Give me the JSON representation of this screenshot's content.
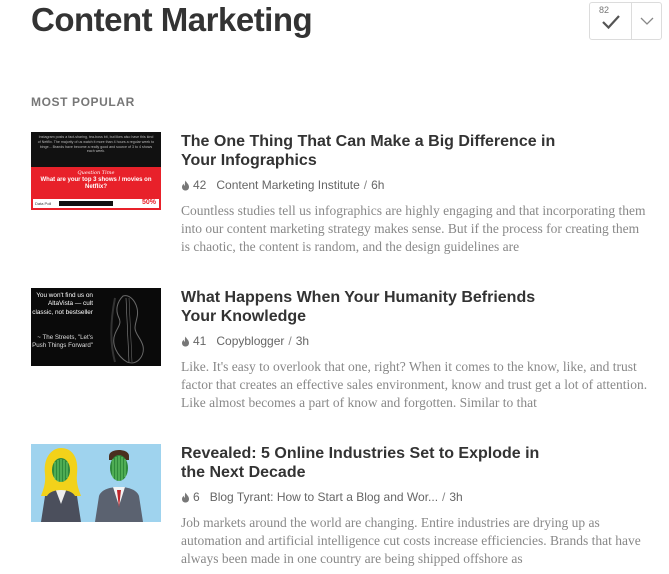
{
  "page": {
    "title": "Content Marketing"
  },
  "follow_control": {
    "count": "82",
    "check_icon": "checkmark-icon",
    "menu_icon": "chevron-down-icon"
  },
  "section": {
    "label": "MOST POPULAR"
  },
  "articles": [
    {
      "headline": "The One Thing That Can Make a Big Difference in Your Infographics",
      "engagement": "42",
      "source": "Content Marketing Institute",
      "age": "6h",
      "summary": "Countless studies tell us infographics are highly engaging and that incorporating them into our content marketing strategy makes sense. But if the process for creating them is chaotic, the content is random, and the design guidelines are",
      "thumbnail": {
        "top_text": "Instagram posts a fact-sharing, tea-boss bit, but likes also have this kind of Netflix. The majority of us watch it more than 4 hours a regular week to binge... Brands have become a really good and source of 3 to 4 shows each week.",
        "quiz_label": "Question Time",
        "question": "What are your top 3 shows / movies on Netflix?",
        "bar_label": "Data Poll",
        "percent": "50%"
      }
    },
    {
      "headline": "What Happens When Your Humanity Befriends Your Knowledge",
      "engagement": "41",
      "source": "Copyblogger",
      "age": "3h",
      "summary": "Like. It's easy to overlook that one, right? When it comes to the know, like, and trust factor that creates an effective sales environment, know and trust get a lot of attention. Like almost becomes a part of know and forgotten. Similar to that",
      "thumbnail": {
        "quote": "You won't find us on AltaVista — cult classic, not bestseller",
        "cite": "~ The Streets, \"Let's Push Things Forward\""
      }
    },
    {
      "headline": "Revealed: 5 Online Industries Set to Explode in the Next Decade",
      "engagement": "6",
      "source": "Blog Tyrant: How to Start a Blog and Wor...",
      "age": "3h",
      "summary": "Job markets around the world are changing. Entire industries are drying up as automation and artificial intelligence cut costs increase efficiencies. Brands that have always been made in one country are being shipped offshore as"
    }
  ],
  "colors": {
    "accent_red": "#e8212a",
    "text_dark": "#333333",
    "text_muted": "#888888"
  }
}
